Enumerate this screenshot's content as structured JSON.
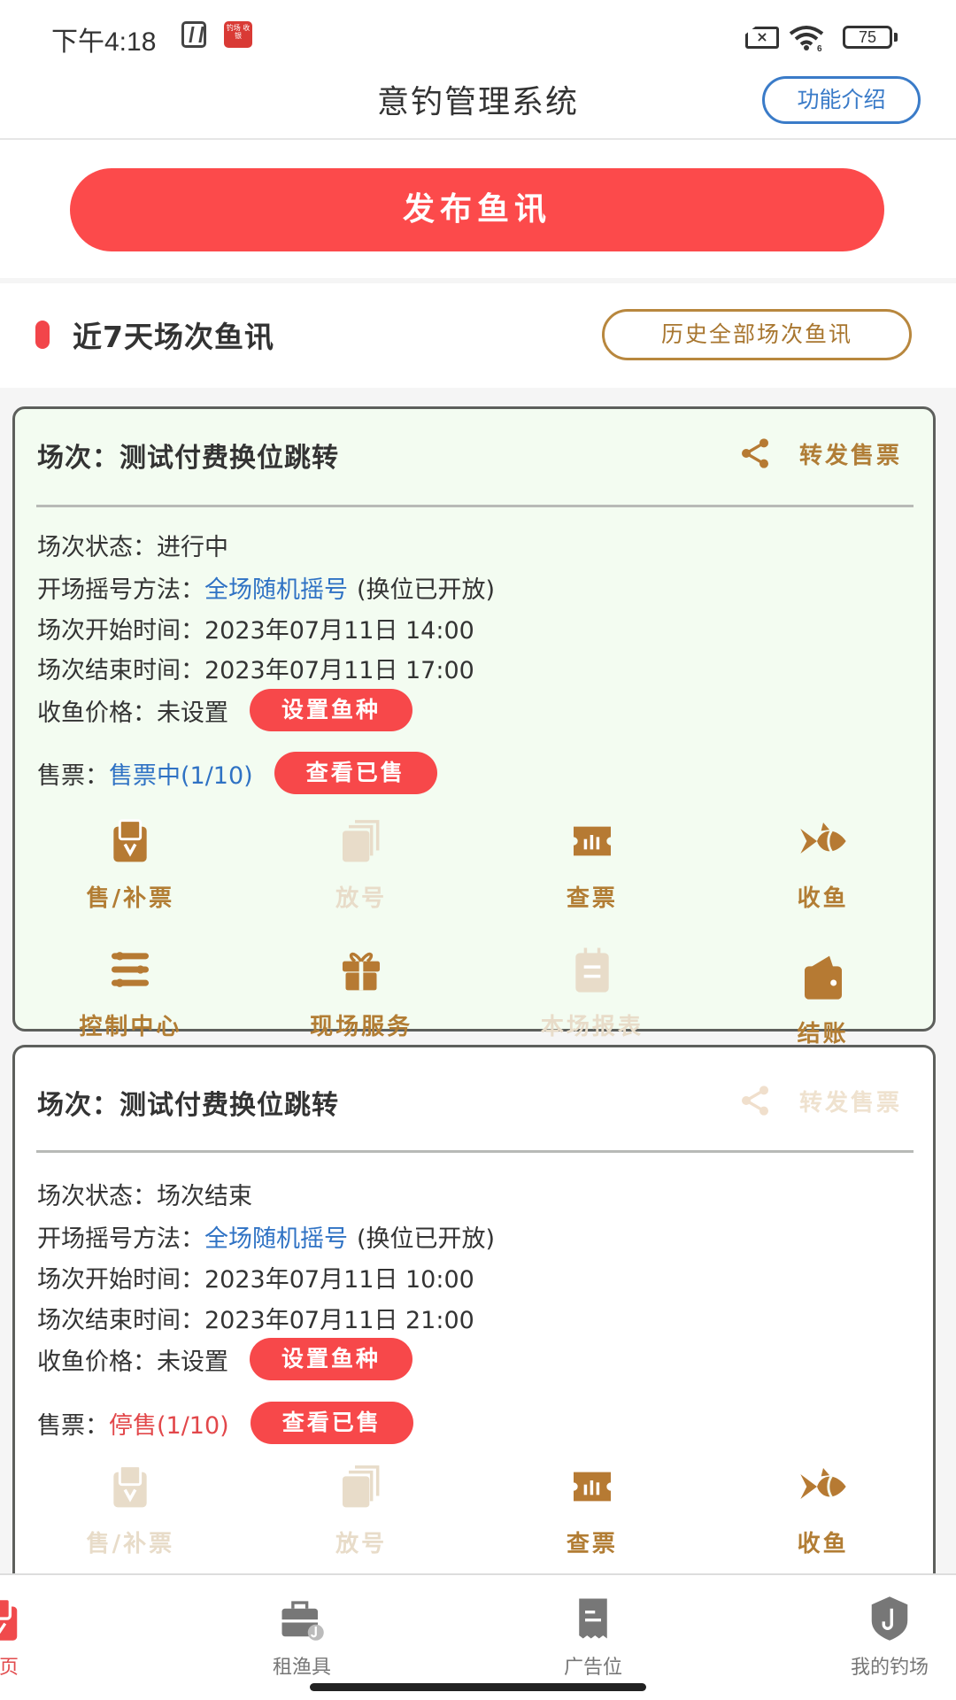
{
  "status_bar": {
    "time": "下午4:18",
    "app_badge_text": "钓场 收银",
    "battery": "75",
    "colors": {
      "app_badge": "#d93a35"
    }
  },
  "header": {
    "title": "意钓管理系统",
    "intro_button": "功能介绍"
  },
  "publish_button": "发布鱼讯",
  "section": {
    "title": "近7天场次鱼讯",
    "history_button": "历史全部场次鱼讯"
  },
  "colors": {
    "primary_red": "#fc4a4b",
    "gold": "#b27d34",
    "gold_disabled": "#e8dcc9",
    "link_blue": "#2f72c4",
    "active_card_bg": "#f3fcf1"
  },
  "sessions": [
    {
      "title": "场次：测试付费换位跳转",
      "share_label": "转发售票",
      "share_enabled": true,
      "status_label": "场次状态：",
      "status_value": "进行中",
      "draw_label": "开场摇号方法：",
      "draw_value": "全场随机摇号",
      "draw_note": "(换位已开放)",
      "start_label": "场次开始时间：",
      "start_value": "2023年07月11日 14:00",
      "end_label": "场次结束时间：",
      "end_value": "2023年07月11日 17:00",
      "price_label": "收鱼价格：",
      "price_value": "未设置",
      "price_button": "设置鱼种",
      "ticket_label": "售票：",
      "ticket_value": "售票中(1/10)",
      "ticket_button": "查看已售",
      "actions": [
        {
          "label": "售/补票",
          "icon": "ticket-sell-icon",
          "enabled": true
        },
        {
          "label": "放号",
          "icon": "stack-icon",
          "enabled": false
        },
        {
          "label": "查票",
          "icon": "ticket-check-icon",
          "enabled": true
        },
        {
          "label": "收鱼",
          "icon": "fish-icon",
          "enabled": true
        },
        {
          "label": "控制中心",
          "icon": "sliders-icon",
          "enabled": true
        },
        {
          "label": "现场服务",
          "icon": "gift-icon",
          "enabled": true
        },
        {
          "label": "本场报表",
          "icon": "report-icon",
          "enabled": false
        },
        {
          "label": "结账",
          "icon": "wallet-icon",
          "enabled": true
        }
      ]
    },
    {
      "title": "场次：测试付费换位跳转",
      "share_label": "转发售票",
      "share_enabled": false,
      "status_label": "场次状态：",
      "status_value": "场次结束",
      "draw_label": "开场摇号方法：",
      "draw_value": "全场随机摇号",
      "draw_note": "(换位已开放)",
      "start_label": "场次开始时间：",
      "start_value": "2023年07月11日 10:00",
      "end_label": "场次结束时间：",
      "end_value": "2023年07月11日 21:00",
      "price_label": "收鱼价格：",
      "price_value": "未设置",
      "price_button": "设置鱼种",
      "ticket_label": "售票：",
      "ticket_value": "停售(1/10)",
      "ticket_button": "查看已售",
      "actions": [
        {
          "label": "售/补票",
          "icon": "ticket-sell-icon",
          "enabled": false
        },
        {
          "label": "放号",
          "icon": "stack-icon",
          "enabled": false
        },
        {
          "label": "查票",
          "icon": "ticket-check-icon",
          "enabled": true
        },
        {
          "label": "收鱼",
          "icon": "fish-icon",
          "enabled": true
        }
      ]
    }
  ],
  "bottom_nav": [
    {
      "label": "首页",
      "icon": "home-icon",
      "active": true
    },
    {
      "label": "租渔具",
      "icon": "toolbox-icon",
      "active": false
    },
    {
      "label": "广告位",
      "icon": "receipt-icon",
      "active": false
    },
    {
      "label": "我的钓场",
      "icon": "shield-hook-icon",
      "active": false
    }
  ]
}
